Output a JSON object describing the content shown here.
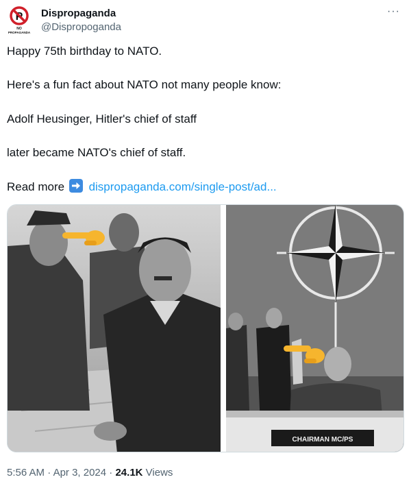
{
  "author": {
    "display_name": "Dispropaganda",
    "handle": "@Dispropoganda",
    "avatar_text": "NO PROPAGANDA"
  },
  "more_label": "···",
  "tweet": {
    "line1": "Happy 75th birthday to NATO.",
    "line2": "Here's a fun fact about NATO not many people know:",
    "line3": "Adolf Heusinger, Hitler's chief of staff",
    "line4": "later became NATO's chief of staff.",
    "read_more": "Read more",
    "link_text": "dispropaganda.com/single-post/ad..."
  },
  "media": {
    "right_sign": "CHAIRMAN MC/PS"
  },
  "meta": {
    "time": "5:56 AM",
    "sep1": " · ",
    "date": "Apr 3, 2024",
    "sep2": " · ",
    "views_count": "24.1K",
    "views_label": " Views"
  },
  "colors": {
    "link": "#1d9bf0",
    "secondary": "#536471",
    "text": "#0f1419"
  }
}
